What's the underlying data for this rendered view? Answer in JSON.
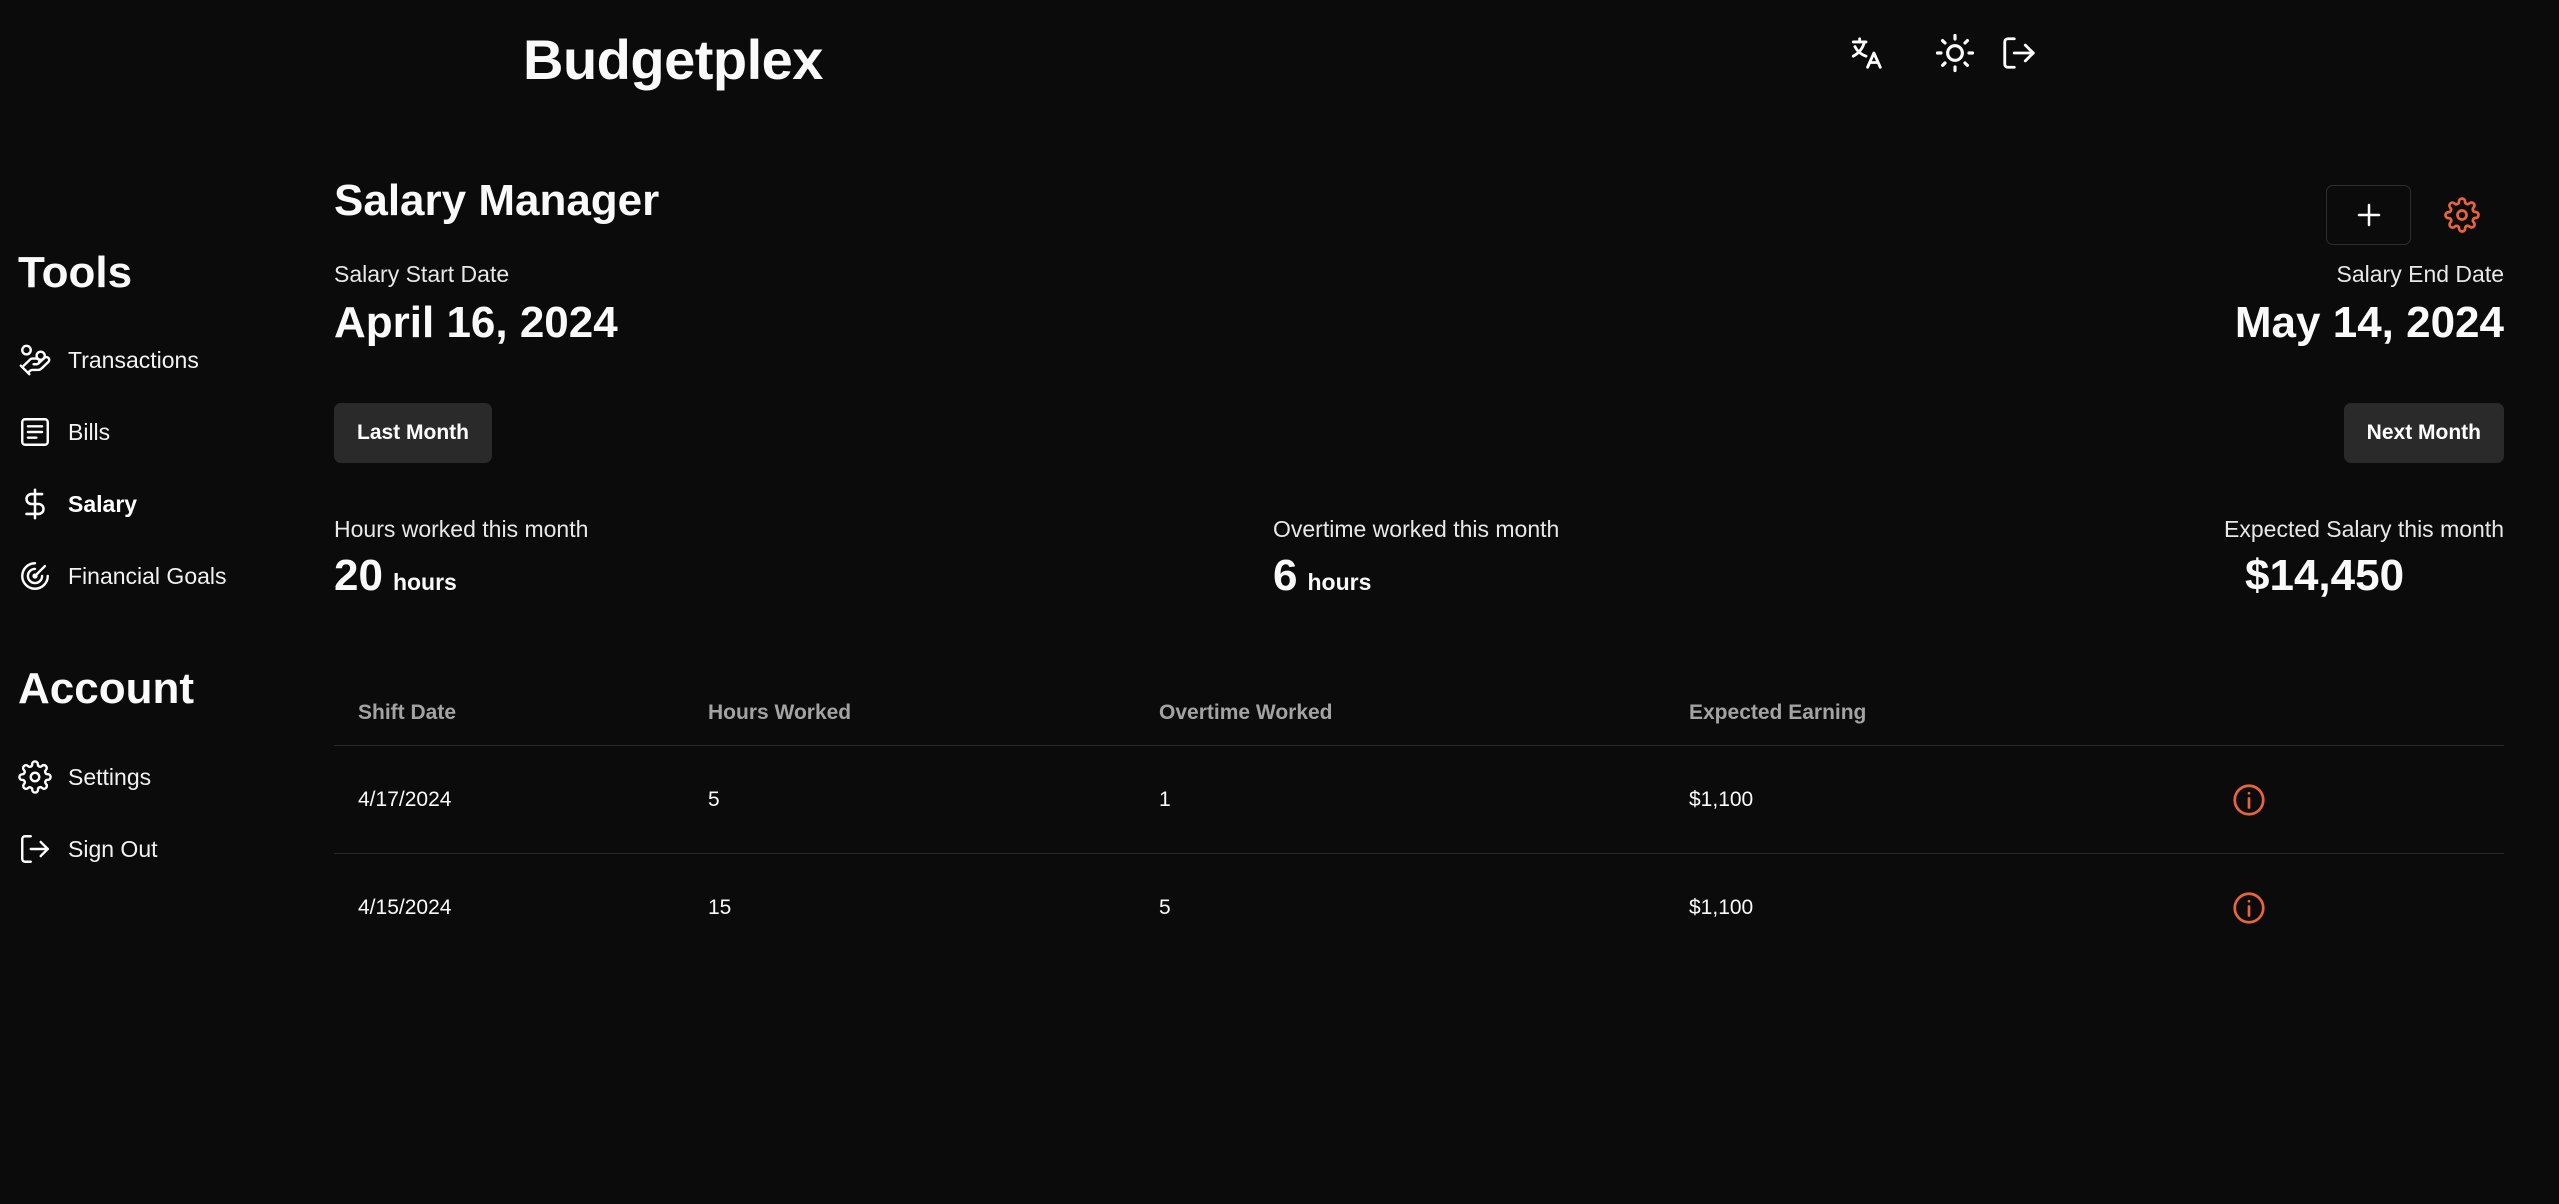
{
  "app": {
    "title": "Budgetplex"
  },
  "header": {
    "icons": [
      "translate-icon",
      "sun-icon",
      "logout-icon"
    ]
  },
  "sidebar": {
    "tools_heading": "Tools",
    "tools": [
      {
        "label": "Transactions",
        "icon": "hand-coins-icon"
      },
      {
        "label": "Bills",
        "icon": "receipt-icon"
      },
      {
        "label": "Salary",
        "icon": "dollar-icon",
        "active": true
      },
      {
        "label": "Financial Goals",
        "icon": "target-icon"
      }
    ],
    "account_heading": "Account",
    "account": [
      {
        "label": "Settings",
        "icon": "gear-icon"
      },
      {
        "label": "Sign Out",
        "icon": "logout-icon"
      }
    ]
  },
  "main": {
    "title": "Salary Manager",
    "start_label": "Salary Start Date",
    "start_date": "April 16, 2024",
    "end_label": "Salary End Date",
    "end_date": "May 14, 2024",
    "prev_button": "Last Month",
    "next_button": "Next Month",
    "stats": {
      "hours_label": "Hours worked this month",
      "hours_value": "20",
      "hours_unit": "hours",
      "overtime_label": "Overtime worked this month",
      "overtime_value": "6",
      "overtime_unit": "hours",
      "salary_label": "Expected Salary this month",
      "salary_value": "$14,450"
    },
    "table": {
      "headers": [
        "Shift Date",
        "Hours Worked",
        "Overtime Worked",
        "Expected Earning"
      ],
      "rows": [
        {
          "date": "4/17/2024",
          "hours": "5",
          "overtime": "1",
          "earning": "$1,100"
        },
        {
          "date": "4/15/2024",
          "hours": "15",
          "overtime": "5",
          "earning": "$1,100"
        }
      ]
    }
  },
  "colors": {
    "background": "#0c0b0b",
    "accent": "#e8643c",
    "button_bg": "#2b2a2a",
    "muted_text": "#a3a3a3"
  }
}
